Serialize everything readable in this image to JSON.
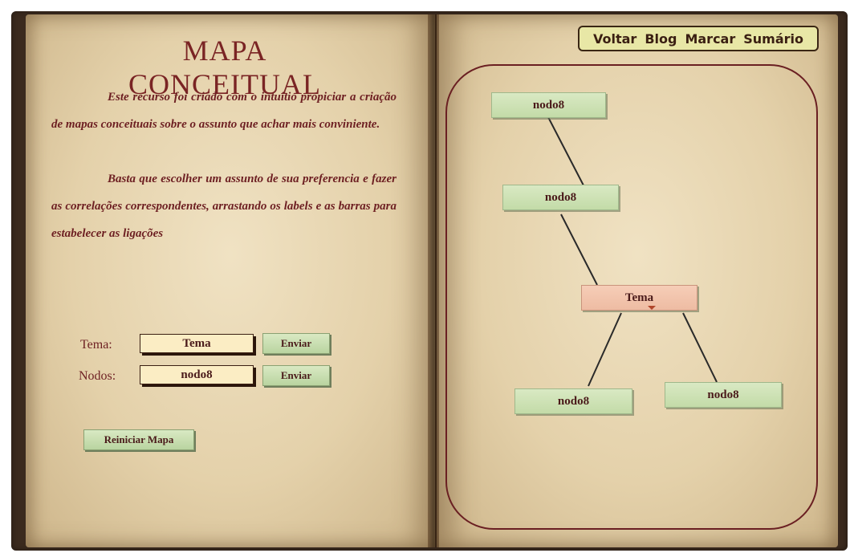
{
  "left_page": {
    "title": "MAPA CONCEITUAL",
    "paragraph1": "Este recurso foi criado com o intuitio propiciar a criação de mapas conceituais sobre o assunto que achar mais conviniente.",
    "paragraph2": "Basta que escolher um assunto  de sua preferencia  e  fazer  as  correlações correspondentes, arrastando os labels e as barras para estabelecer as ligações",
    "tema_label": "Tema:",
    "tema_value": "Tema",
    "tema_send": "Enviar",
    "nodos_label": "Nodos:",
    "nodos_value": "nodo8",
    "nodos_send": "Enviar",
    "reset_button": "Reiniciar Mapa"
  },
  "nav": {
    "voltar": "Voltar",
    "blog": "Blog",
    "marcar": "Marcar",
    "sumario": "Sumário"
  },
  "map": {
    "nodes": [
      {
        "label": "nodo8"
      },
      {
        "label": "nodo8"
      },
      {
        "label": "Tema"
      },
      {
        "label": "nodo8"
      },
      {
        "label": "nodo8"
      }
    ]
  },
  "colors": {
    "text": "#6d1f22",
    "node_green": "#c3dba8",
    "node_tema": "#eebca3",
    "nav_bg": "#e8e7a6"
  }
}
